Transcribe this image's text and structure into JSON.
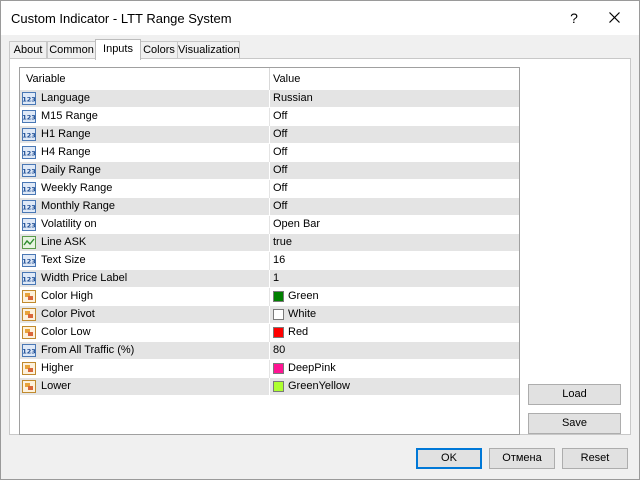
{
  "window": {
    "title": "Custom Indicator - LTT Range System",
    "help_label": "?"
  },
  "tabs": [
    {
      "label": "About"
    },
    {
      "label": "Common"
    },
    {
      "label": "Inputs",
      "active": true
    },
    {
      "label": "Colors"
    },
    {
      "label": "Visualization"
    }
  ],
  "grid": {
    "col_variable": "Variable",
    "col_value": "Value",
    "rows": [
      {
        "name": "Language",
        "value": "Russian",
        "icon": "number-param-icon"
      },
      {
        "name": "M15 Range",
        "value": "Off",
        "icon": "number-param-icon"
      },
      {
        "name": "H1 Range",
        "value": "Off",
        "icon": "number-param-icon"
      },
      {
        "name": "H4 Range",
        "value": "Off",
        "icon": "number-param-icon"
      },
      {
        "name": "Daily Range",
        "value": "Off",
        "icon": "number-param-icon"
      },
      {
        "name": "Weekly Range",
        "value": "Off",
        "icon": "number-param-icon"
      },
      {
        "name": "Monthly Range",
        "value": "Off",
        "icon": "number-param-icon"
      },
      {
        "name": "Volatility on",
        "value": "Open Bar",
        "icon": "number-param-icon"
      },
      {
        "name": "Line ASK",
        "value": "true",
        "icon": "bool-param-icon"
      },
      {
        "name": "Text Size",
        "value": "16",
        "icon": "number-param-icon"
      },
      {
        "name": "Width Price Label",
        "value": "1",
        "icon": "number-param-icon"
      },
      {
        "name": "Color High",
        "value": "Green",
        "icon": "color-param-icon",
        "swatch": "#008000"
      },
      {
        "name": "Color Pivot",
        "value": "White",
        "icon": "color-param-icon",
        "swatch": "#ffffff"
      },
      {
        "name": "Color Low",
        "value": "Red",
        "icon": "color-param-icon",
        "swatch": "#ff0000"
      },
      {
        "name": "From All Traffic (%)",
        "value": "80",
        "icon": "number-param-icon"
      },
      {
        "name": "Higher",
        "value": "DeepPink",
        "icon": "color-param-icon",
        "swatch": "#ff1493"
      },
      {
        "name": "Lower",
        "value": "GreenYellow",
        "icon": "color-param-icon",
        "swatch": "#adff2f"
      }
    ]
  },
  "side_buttons": {
    "load_label": "Load",
    "save_label": "Save"
  },
  "footer": {
    "ok_label": "OK",
    "cancel_label": "Отмена",
    "reset_label": "Reset"
  },
  "colors": {
    "accent": "#0078d7",
    "row_alt": "#e4e4e4"
  }
}
